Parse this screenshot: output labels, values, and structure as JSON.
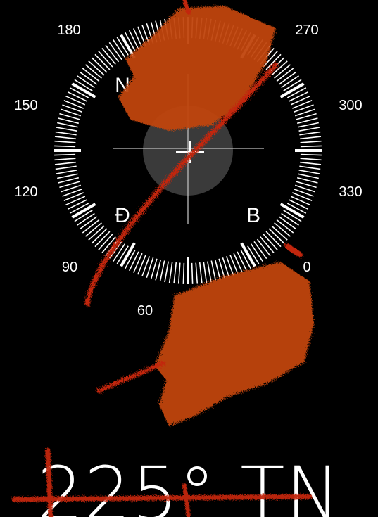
{
  "compass": {
    "degree_labels": [
      "180",
      "270",
      "150",
      "300",
      "120",
      "330",
      "90",
      "0",
      "60"
    ],
    "cardinals": [
      "N",
      "Đ",
      "B"
    ]
  },
  "readout": {
    "value": "225°",
    "reference": "TN"
  },
  "colors": {
    "background": "#000000",
    "foreground": "#ffffff",
    "scribble": "#c0440f",
    "scribble_dark": "#c2260c"
  }
}
